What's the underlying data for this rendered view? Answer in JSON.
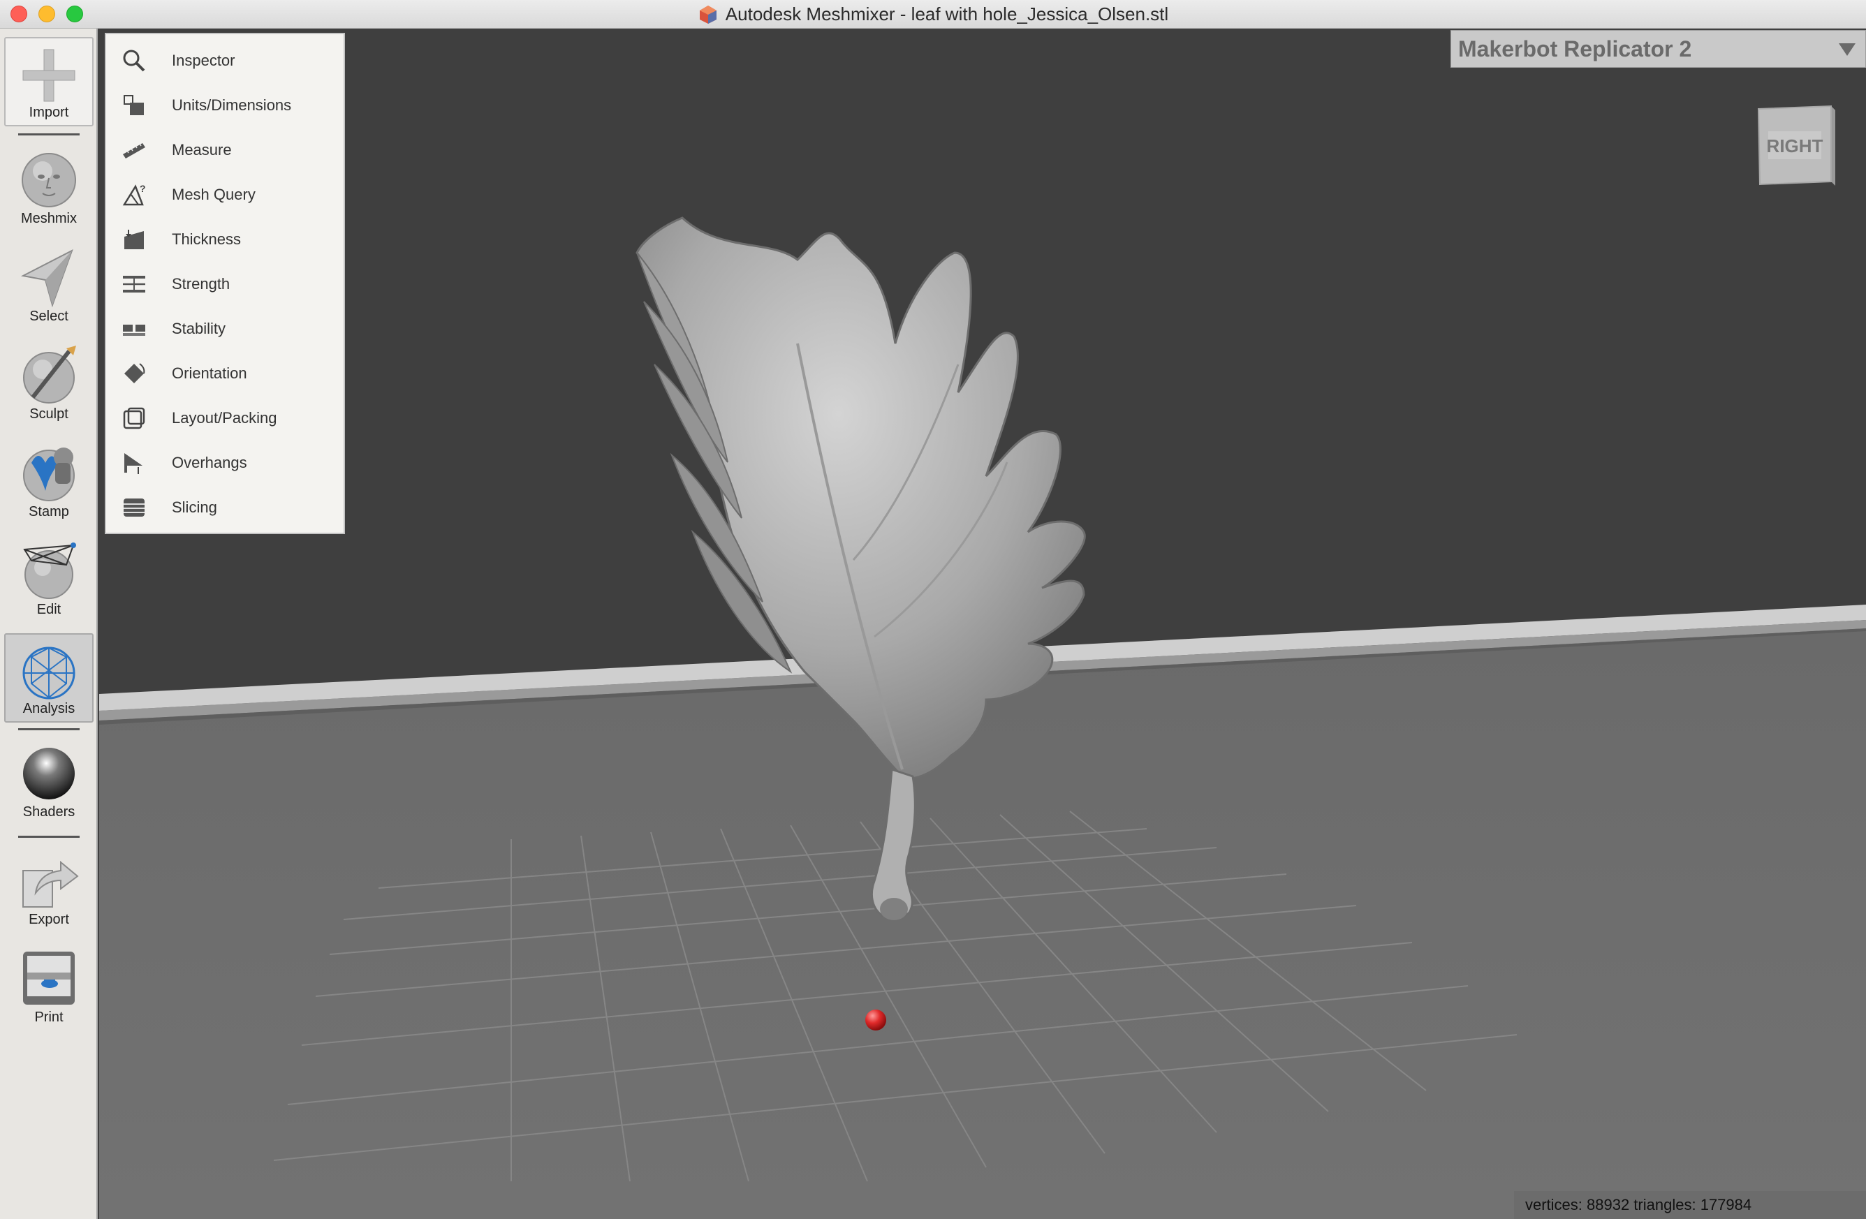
{
  "window": {
    "title": "Autodesk Meshmixer - leaf with hole_Jessica_Olsen.stl"
  },
  "toolbar": {
    "tools": [
      {
        "label": "Import",
        "icon": "plus-icon"
      },
      {
        "label": "Meshmix",
        "icon": "face-sphere-icon"
      },
      {
        "label": "Select",
        "icon": "arrow-cursor-icon"
      },
      {
        "label": "Sculpt",
        "icon": "brush-sphere-icon"
      },
      {
        "label": "Stamp",
        "icon": "stamp-sphere-icon"
      },
      {
        "label": "Edit",
        "icon": "mesh-edit-sphere-icon"
      },
      {
        "label": "Analysis",
        "icon": "wireframe-sphere-icon"
      },
      {
        "label": "Shaders",
        "icon": "shiny-sphere-icon"
      },
      {
        "label": "Export",
        "icon": "export-arrow-icon"
      },
      {
        "label": "Print",
        "icon": "printer-icon"
      }
    ],
    "active": "Analysis"
  },
  "analysis_menu": {
    "items": [
      {
        "label": "Inspector",
        "icon": "magnifier-icon"
      },
      {
        "label": "Units/Dimensions",
        "icon": "units-icon"
      },
      {
        "label": "Measure",
        "icon": "ruler-icon"
      },
      {
        "label": "Mesh Query",
        "icon": "mesh-query-icon"
      },
      {
        "label": "Thickness",
        "icon": "thickness-icon"
      },
      {
        "label": "Strength",
        "icon": "strength-icon"
      },
      {
        "label": "Stability",
        "icon": "stability-icon"
      },
      {
        "label": "Orientation",
        "icon": "orientation-icon"
      },
      {
        "label": "Layout/Packing",
        "icon": "layout-packing-icon"
      },
      {
        "label": "Overhangs",
        "icon": "overhangs-icon"
      },
      {
        "label": "Slicing",
        "icon": "slicing-icon"
      }
    ]
  },
  "printer": {
    "selected": "Makerbot Replicator 2"
  },
  "viewcube": {
    "face": "RIGHT"
  },
  "status": {
    "text": "vertices: 88932 triangles: 177984"
  },
  "colors": {
    "viewport_back": "#3f3f3f",
    "viewport_floor": "#6e6e6e",
    "model": "#b8b8b8",
    "pivot": "#e03030"
  }
}
